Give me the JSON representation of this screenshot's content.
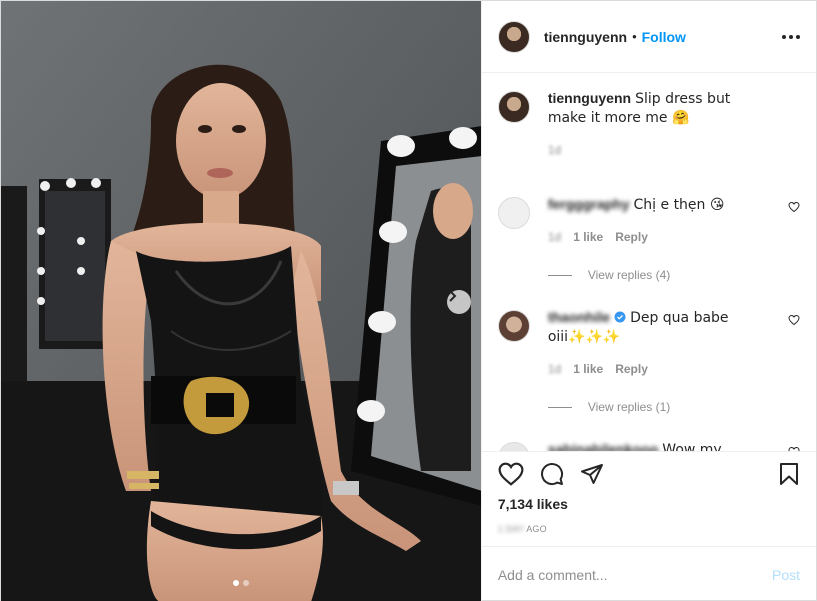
{
  "post": {
    "username": "tiennguyenn",
    "separator": "•",
    "follow_label": "Follow",
    "more_icon": "more-horizontal-icon",
    "caption": {
      "username": "tiennguyenn",
      "text": "Slip dress but make it more me 🤗",
      "time": "1d"
    },
    "comments": [
      {
        "username": "fergggraphy",
        "text": "Chị e thẹn 😘",
        "time": "1d",
        "likes": "1 like",
        "reply": "Reply",
        "view_replies": "View replies (4)"
      },
      {
        "username": "thaonhile",
        "verified": true,
        "text": "Dep qua babe oiii✨✨✨",
        "time": "1d",
        "likes": "1 like",
        "reply": "Reply",
        "view_replies": "View replies (1)"
      },
      {
        "username": "sabinabilenkooo",
        "text": "Wow my beautiful Tiena 😍❤️❤️❤️🔥💥"
      }
    ],
    "likes": "7,134 likes",
    "date_blur": "1 DAY",
    "ago": "AGO",
    "add_comment_placeholder": "Add a comment...",
    "post_label": "Post",
    "colors": {
      "follow": "#0095f6",
      "post_disabled": "#b2dffc",
      "muted": "#8e8e8e",
      "verified": "#3897f0"
    },
    "carousel": {
      "total": 2,
      "active": 1
    }
  }
}
